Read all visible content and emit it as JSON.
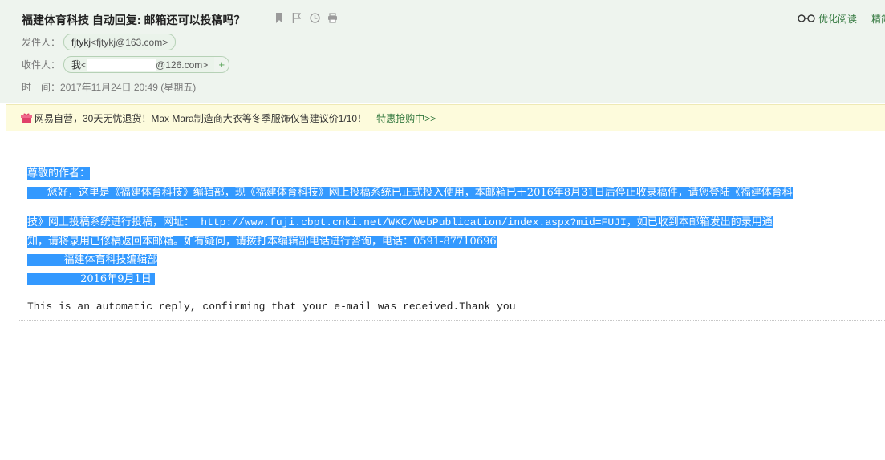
{
  "header": {
    "subject": "福建体育科技 自动回复: 邮箱还可以投稿吗？",
    "actions": {
      "optimize_read": "优化阅读",
      "more": "精简"
    },
    "from": {
      "label": "发件人：",
      "name": "fjtykj",
      "addr": "<fjtykj@163.com>"
    },
    "to": {
      "label": "收件人：",
      "name": "我",
      "addr_prefix": "<",
      "addr_suffix": "@126.com>",
      "plus": "+"
    },
    "time": {
      "label": "时　间：",
      "value": "2017年11月24日 20:49 (星期五)"
    }
  },
  "ad": {
    "text": "网易自营，30天无忧退货！Max Mara制造商大衣等冬季服饰仅售建议价1/10！",
    "link": "特惠抢购中>>"
  },
  "body": {
    "greeting": "尊敬的作者：",
    "p1": "      您好，这里是《福建体育科技》编辑部，现《福建体育科技》网上投稿系统已正式投入使用，本邮箱已于2016年8月31日后停止收录稿件，请您登陆《福建体育科",
    "p2a": "技》网上投稿系统进行投稿，网址：  ",
    "url": "http://www.fuji.cbpt.cnki.net/WKC/WebPublication/index.aspx?mid=FUJI",
    "p2b": "，如已收到本邮箱发出的录用通",
    "p3": "知，请将录用已修稿返回本邮箱。如有疑问，请拨打本编辑部电话进行咨询，电话：0591-87710696",
    "sign": "           福建体育科技编辑部",
    "date": "                2016年9月1日 ",
    "auto_reply": "This is an automatic reply, confirming that your e-mail was received.Thank you"
  },
  "colors": {
    "accent": "#31773d",
    "selection": "#3399ff",
    "header_bg": "#eef4ee",
    "ad_bg": "#fdfbdc"
  }
}
